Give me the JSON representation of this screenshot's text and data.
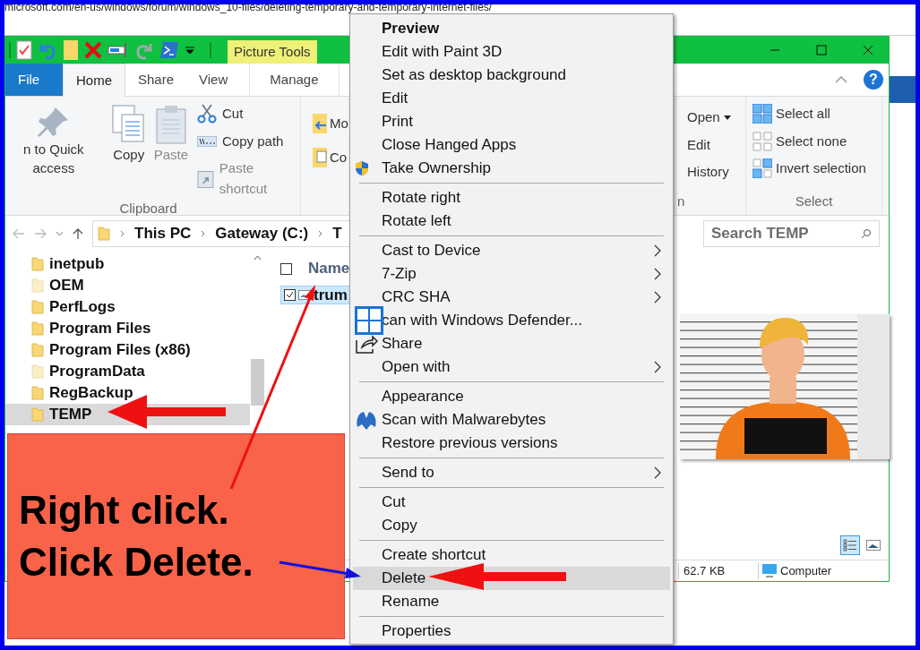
{
  "browser": {
    "url": "microsoft.com/en-us/windows/forum/windows_10-files/deleting-temporary-and-temporary-internet-files/"
  },
  "titlebar": {
    "context_tab_group": "Picture Tools"
  },
  "ribbon_tabs": [
    {
      "label": "File",
      "selected": false,
      "kind": "file"
    },
    {
      "label": "Home",
      "selected": true,
      "kind": "tab"
    },
    {
      "label": "Share",
      "selected": false,
      "kind": "tab"
    },
    {
      "label": "View",
      "selected": false,
      "kind": "tab"
    },
    {
      "label": "Manage",
      "selected": false,
      "kind": "context"
    }
  ],
  "help": "?",
  "clipboard": {
    "label": "Clipboard",
    "pin": "n to Quick access",
    "copy": "Copy",
    "paste": "Paste",
    "cut": "Cut",
    "copy_path": "Copy path",
    "paste_shortcut": "Paste shortcut",
    "paste_disabled": true
  },
  "organize": {
    "move": "Mo",
    "copy": "Co"
  },
  "open_group": {
    "label": "n",
    "open": "Open",
    "edit": "Edit",
    "history": "History"
  },
  "select_group": {
    "label": "Select",
    "select_all": "Select all",
    "select_none": "Select none",
    "invert": "Invert selection"
  },
  "address": {
    "crumbs": [
      "This PC",
      "Gateway (C:)",
      "T"
    ],
    "search_placeholder": "Search TEMP"
  },
  "nav_items": [
    {
      "label": "inetpub",
      "hidden": false,
      "selected": false
    },
    {
      "label": "OEM",
      "hidden": true,
      "selected": false
    },
    {
      "label": "PerfLogs",
      "hidden": false,
      "selected": false
    },
    {
      "label": "Program Files",
      "hidden": false,
      "selected": false
    },
    {
      "label": "Program Files (x86)",
      "hidden": false,
      "selected": false
    },
    {
      "label": "ProgramData",
      "hidden": true,
      "selected": false
    },
    {
      "label": "RegBackup",
      "hidden": false,
      "selected": false
    },
    {
      "label": "TEMP",
      "hidden": false,
      "selected": true
    }
  ],
  "file_list": {
    "header": "Name",
    "header_checked": false,
    "rows": [
      {
        "name": "trum",
        "checked": true,
        "selected": true
      }
    ]
  },
  "preview": {
    "kind": "picture"
  },
  "status_bar": {
    "size": "62.7 KB",
    "zone": "Computer"
  },
  "views": [
    {
      "kind": "details",
      "selected": true
    },
    {
      "kind": "large",
      "selected": false
    }
  ],
  "context_menu": [
    [
      {
        "label": "Preview",
        "kind": "default",
        "submenu": false,
        "selected": false
      },
      {
        "label": "Edit with Paint 3D",
        "kind": "plain",
        "submenu": false,
        "selected": false
      },
      {
        "label": "Set as desktop background",
        "kind": "plain",
        "submenu": false,
        "selected": false
      },
      {
        "label": "Edit",
        "kind": "plain",
        "submenu": false,
        "selected": false
      },
      {
        "label": "Print",
        "kind": "plain",
        "submenu": false,
        "selected": false
      },
      {
        "label": "Close Hanged Apps",
        "kind": "plain",
        "submenu": false,
        "selected": false
      },
      {
        "label": "Take Ownership",
        "kind": "shield",
        "submenu": false,
        "selected": false
      }
    ],
    [
      {
        "label": "Rotate right",
        "kind": "plain",
        "submenu": false,
        "selected": false
      },
      {
        "label": "Rotate left",
        "kind": "plain",
        "submenu": false,
        "selected": false
      }
    ],
    [
      {
        "label": "Cast to Device",
        "kind": "plain",
        "submenu": true,
        "selected": false
      },
      {
        "label": "7-Zip",
        "kind": "plain",
        "submenu": true,
        "selected": false
      },
      {
        "label": "CRC SHA",
        "kind": "plain",
        "submenu": true,
        "selected": false
      },
      {
        "label": "can with Windows Defender...",
        "kind": "defender",
        "submenu": false,
        "selected": false
      },
      {
        "label": "Share",
        "kind": "share",
        "submenu": false,
        "selected": false
      },
      {
        "label": "Open with",
        "kind": "plain",
        "submenu": true,
        "selected": false
      }
    ],
    [
      {
        "label": "Appearance",
        "kind": "plain",
        "submenu": false,
        "selected": false
      },
      {
        "label": "Scan with Malwarebytes",
        "kind": "malwarebytes",
        "submenu": false,
        "selected": false
      },
      {
        "label": "Restore previous versions",
        "kind": "plain",
        "submenu": false,
        "selected": false
      }
    ],
    [
      {
        "label": "Send to",
        "kind": "plain",
        "submenu": true,
        "selected": false
      }
    ],
    [
      {
        "label": "Cut",
        "kind": "plain",
        "submenu": false,
        "selected": false
      },
      {
        "label": "Copy",
        "kind": "plain",
        "submenu": false,
        "selected": false
      }
    ],
    [
      {
        "label": "Create shortcut",
        "kind": "plain",
        "submenu": false,
        "selected": false
      },
      {
        "label": "Delete",
        "kind": "plain",
        "submenu": false,
        "selected": true
      },
      {
        "label": "Rename",
        "kind": "plain",
        "submenu": false,
        "selected": false
      }
    ],
    [
      {
        "label": "Properties",
        "kind": "plain",
        "submenu": false,
        "selected": false
      }
    ]
  ],
  "annotation": {
    "lines": [
      "Right click.",
      "Click Delete."
    ]
  }
}
